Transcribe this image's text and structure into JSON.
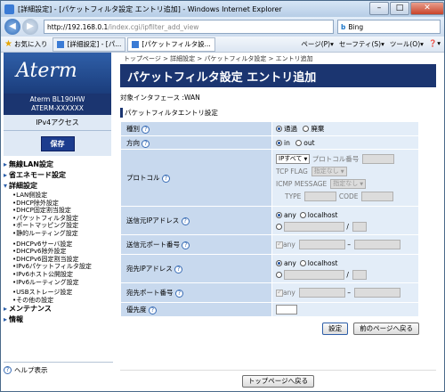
{
  "window": {
    "title": "[詳細設定] - [パケットフィルタ設定 エントリ追加] - Windows Internet Explorer",
    "min": "–",
    "max": "□",
    "close": "✕"
  },
  "addressbar": {
    "url_prefix": "http://192.168.0.1",
    "url_rest": "/index.cgi/ipfilter_add_view",
    "search_label": "Bing",
    "back": "◀",
    "forward": "▶"
  },
  "favbar": {
    "favorites_label": "お気に入り",
    "tabs": [
      "[詳細設定] - [パ...",
      "[パケットフィルタ設..."
    ],
    "commands": [
      "ページ(P)▾",
      "セーフティ(S)▾",
      "ツール(O)▾",
      "❓▾"
    ]
  },
  "sidebar": {
    "logo": "Aterm",
    "model_line1": "Aterm BL190HW",
    "model_line2": "ATERM-XXXXXX",
    "ipv4": "IPv4アクセス",
    "save": "保存",
    "sections": [
      {
        "title": "無線LAN設定",
        "items": []
      },
      {
        "title": "省エネモード設定",
        "items": []
      },
      {
        "title": "詳細設定",
        "items": [
          "LAN側設定",
          "DHCP除外設定",
          "DHCP固定割当設定",
          "パケットフィルタ設定",
          "ポートマッピング設定",
          "静的ルーティング設定",
          "",
          "DHCPv6サーバ設定",
          "DHCPv6除外設定",
          "DHCPv6固定割当設定",
          "IPv6パケットフィルタ設定",
          "IPv6ホスト公開設定",
          "IPv6ルーティング設定",
          "",
          "USBストレージ設定",
          "その他の設定"
        ]
      },
      {
        "title": "メンテナンス",
        "items": []
      },
      {
        "title": "情報",
        "items": []
      }
    ],
    "help": "ヘルプ表示"
  },
  "main": {
    "breadcrumb": "トップページ > 詳細設定 > パケットフィルタ設定 > エントリ追加",
    "title": "パケットフィルタ設定 エントリ追加",
    "interface": "対象インタフェース :WAN",
    "section": "パケットフィルタエントリ設定",
    "rows": {
      "kind": {
        "label": "種別",
        "opt1": "通過",
        "opt2": "廃棄"
      },
      "direction": {
        "label": "方向",
        "opt1": "in",
        "opt2": "out"
      },
      "protocol": {
        "label": "プロトコル",
        "select": "IPすべて",
        "proto_no": "プロトコル番号",
        "tcp_flag": "TCP FLAG",
        "tcp_sel": "指定なし",
        "icmp": "ICMP MESSAGE",
        "icmp_sel": "指定なし",
        "type": "TYPE",
        "code": "CODE"
      },
      "src_ip": {
        "label": "送信元IPアドレス",
        "any": "any",
        "localhost": "localhost",
        "slash": "/"
      },
      "src_port": {
        "label": "送信元ポート番号",
        "any": "any",
        "dash": "–"
      },
      "dst_ip": {
        "label": "宛先IPアドレス",
        "any": "any",
        "localhost": "localhost",
        "slash": "/"
      },
      "dst_port": {
        "label": "宛先ポート番号",
        "any": "any",
        "dash": "–"
      },
      "priority": {
        "label": "優先度"
      }
    },
    "buttons": {
      "set": "設定",
      "back": "前のページへ戻る",
      "top": "トップページへ戻る"
    },
    "help_mark": "?"
  }
}
